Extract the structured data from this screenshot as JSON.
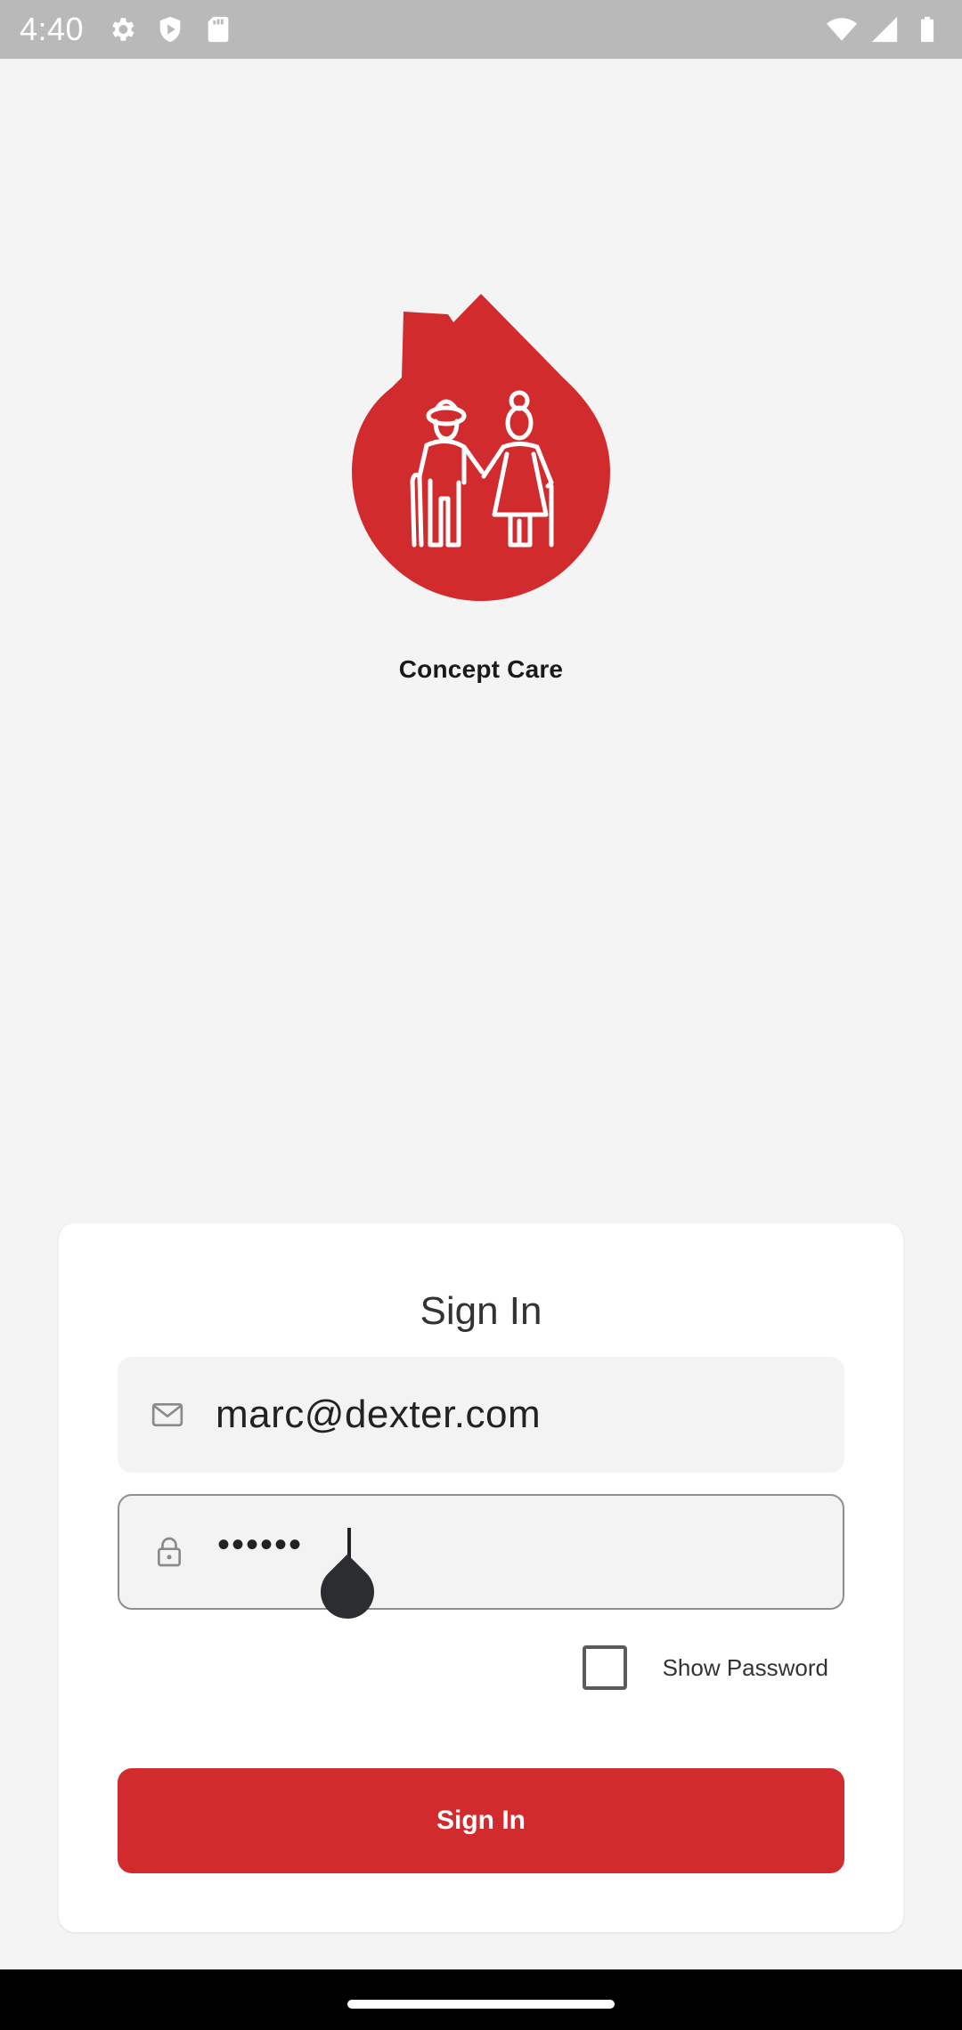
{
  "status_bar": {
    "time": "4:40",
    "left_icons": [
      "gear-icon",
      "shield-icon",
      "sd-card-icon"
    ],
    "right_icons": [
      "wifi-icon",
      "signal-icon",
      "battery-icon"
    ]
  },
  "brand": {
    "name": "Concept Care",
    "logo": "care-home-logo",
    "color": "#d12b2e"
  },
  "sign_in_card": {
    "title": "Sign In",
    "email": {
      "icon": "mail-icon",
      "value": "marc@dexter.com"
    },
    "password": {
      "icon": "lock-icon",
      "masked_value": "••••••"
    },
    "show_password": {
      "label": "Show Password",
      "checked": false
    },
    "submit_label": "Sign In"
  }
}
